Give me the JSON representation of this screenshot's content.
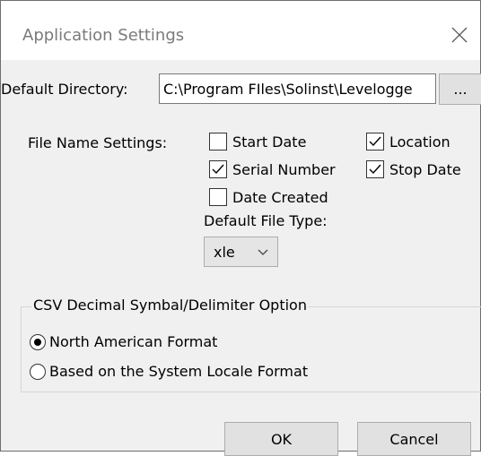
{
  "window": {
    "title": "Application Settings"
  },
  "directory": {
    "label": "Default Directory:",
    "value": "C:\\Program FIles\\Solinst\\Levelogge",
    "browse_label": "..."
  },
  "file_name_settings": {
    "label": "File Name Settings:",
    "options": [
      {
        "label": "Start Date",
        "checked": false
      },
      {
        "label": "Location",
        "checked": true
      },
      {
        "label": "Serial Number",
        "checked": true
      },
      {
        "label": "Stop Date",
        "checked": true
      },
      {
        "label": "Date Created",
        "checked": false
      }
    ]
  },
  "file_type": {
    "label": "Default File Type:",
    "value": "xle"
  },
  "csv_group": {
    "title": "CSV Decimal Symbal/Delimiter Option",
    "options": [
      {
        "label": "North American Format",
        "selected": true
      },
      {
        "label": "Based on the System Locale Format",
        "selected": false
      }
    ]
  },
  "buttons": {
    "ok": "OK",
    "cancel": "Cancel"
  },
  "icons": {
    "close": "close-icon",
    "check": "check-icon",
    "dropdown": "chevron-down-icon"
  }
}
